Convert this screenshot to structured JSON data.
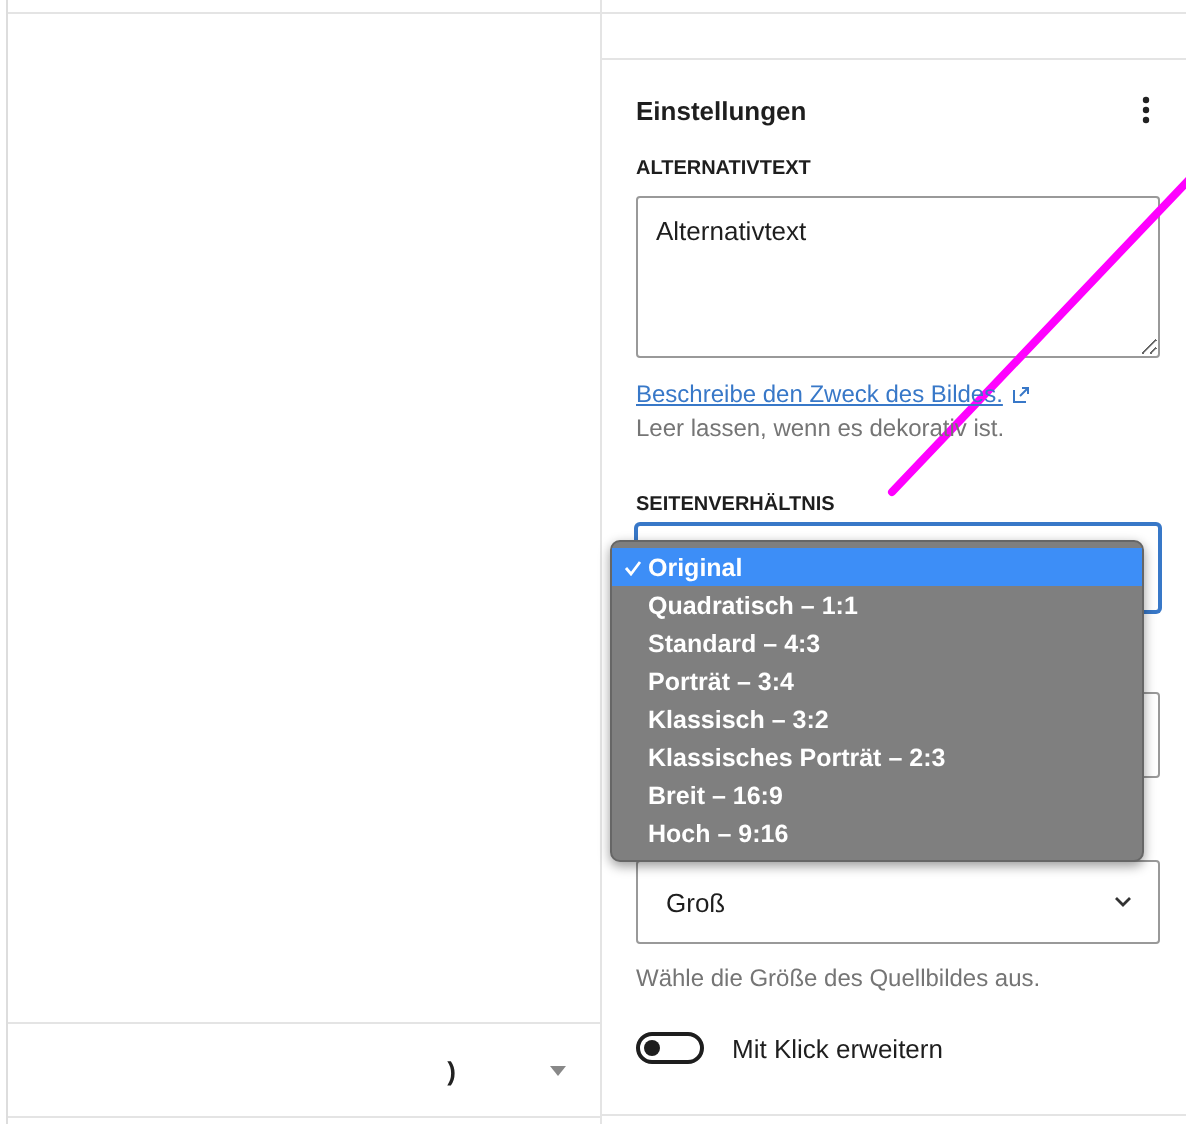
{
  "left_panel": {
    "bottom_row": {
      "value": ")"
    }
  },
  "settings": {
    "title": "Einstellungen",
    "alt_text": {
      "label": "ALTERNATIVTEXT",
      "value": "Alternativtext",
      "link": "Beschreibe den Zweck des Bildes.",
      "help": "Leer lassen, wenn es dekorativ ist."
    },
    "aspect_ratio": {
      "label": "SEITENVERHÄLTNIS",
      "options": [
        {
          "label": "Original",
          "selected": true
        },
        {
          "label": "Quadratisch – 1:1",
          "selected": false
        },
        {
          "label": "Standard – 4:3",
          "selected": false
        },
        {
          "label": "Porträt – 3:4",
          "selected": false
        },
        {
          "label": "Klassisch – 3:2",
          "selected": false
        },
        {
          "label": "Klassisches Porträt – 2:3",
          "selected": false
        },
        {
          "label": "Breit – 16:9",
          "selected": false
        },
        {
          "label": "Hoch – 9:16",
          "selected": false
        }
      ]
    },
    "resolution": {
      "value": "Groß",
      "help": "Wähle die Größe des Quellbildes aus."
    },
    "link_toggle": {
      "label": "Mit Klick erweitern",
      "on": false
    }
  }
}
